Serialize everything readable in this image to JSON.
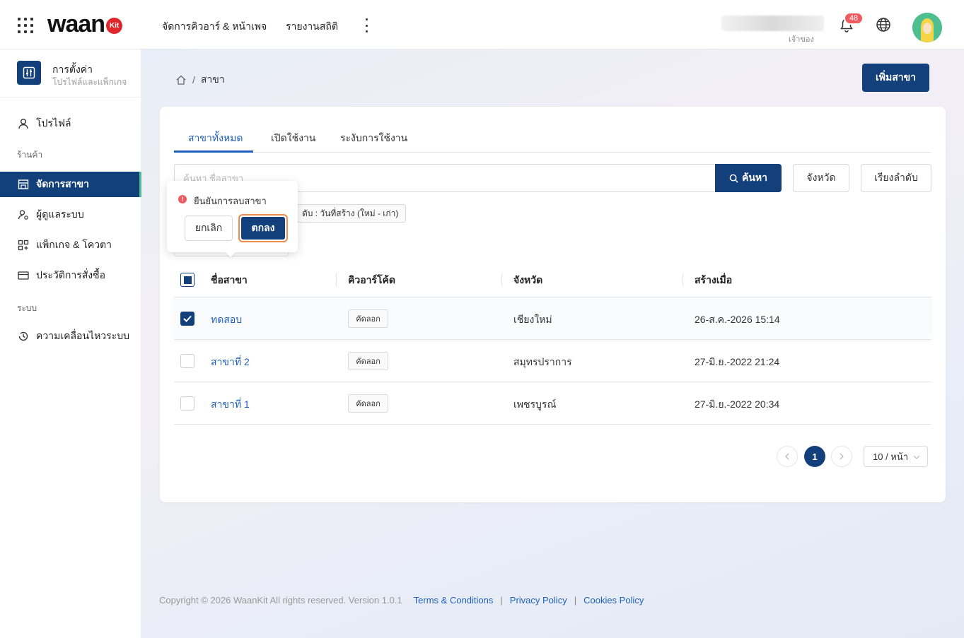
{
  "header": {
    "logo_text": "waan",
    "logo_badge": "Kit",
    "nav": [
      "จัดการคิวอาร์ & หน้าเพจ",
      "รายงานสถิติ"
    ],
    "user_role": "เจ้าของ",
    "notification_count": "48"
  },
  "sidebar": {
    "settings_title": "การตั้งค่า",
    "settings_subtitle": "โปรไฟล์และแพ็กเกจ",
    "profile": "โปรไฟล์",
    "group_store": "ร้านค้า",
    "manage_branches": "จัดการสาขา",
    "admins": "ผู้ดูแลระบบ",
    "packages": "แพ็กเกจ & โควตา",
    "order_history": "ประวัติการสั่งซื้อ",
    "group_system": "ระบบ",
    "system_activity": "ความเคลื่อนไหวระบบ"
  },
  "breadcrumb": {
    "current": "สาขา"
  },
  "add_button": "เพิ่มสาขา",
  "tabs": [
    "สาขาทั้งหมด",
    "เปิดใช้งาน",
    "ระงับการใช้งาน"
  ],
  "search": {
    "placeholder": "ค้นหา ชื่อสาขา",
    "button": "ค้นหา",
    "province_button": "จังหวัด",
    "sort_button": "เรียงลำดับ"
  },
  "sort_tag": "ดับ : วันที่สร้าง (ใหม่ - เก่า)",
  "table": {
    "columns": [
      "ชื่อสาขา",
      "คิวอาร์โค้ด",
      "จังหวัด",
      "สร้างเมื่อ"
    ],
    "copy_label": "คัดลอก",
    "rows": [
      {
        "name": "ทดสอบ",
        "province": "เชียงใหม่",
        "created": "26-ส.ค.-2026 15:14",
        "checked": true
      },
      {
        "name": "สาขาที่ 2",
        "province": "สมุทรปราการ",
        "created": "27-มิ.ย.-2022 21:24",
        "checked": false
      },
      {
        "name": "สาขาที่ 1",
        "province": "เพชรบูรณ์",
        "created": "27-มิ.ย.-2022 20:34",
        "checked": false
      }
    ]
  },
  "pagination": {
    "current": "1",
    "page_size": "10 / หน้า"
  },
  "popconfirm": {
    "message": "ยืนยันการลบสาขา",
    "cancel": "ยกเลิก",
    "ok": "ตกลง"
  },
  "footer": {
    "copyright": "Copyright © 2026 WaanKit All rights reserved. Version 1.0.1",
    "terms": "Terms & Conditions",
    "privacy": "Privacy Policy",
    "cookies": "Cookies Policy"
  },
  "colors": {
    "primary": "#13407a",
    "link": "#1f61b8",
    "danger": "#f05a5f",
    "accent": "#4fbf8f"
  }
}
